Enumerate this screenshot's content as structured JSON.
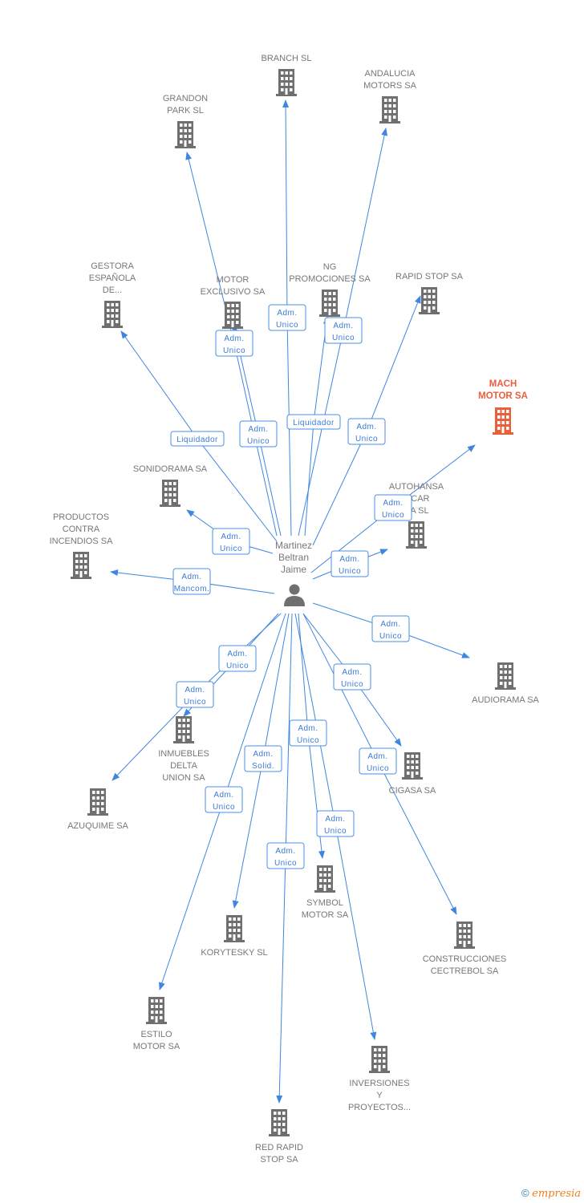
{
  "center": {
    "name_lines": [
      "Martinez",
      "Beltran",
      "Jaime"
    ],
    "icon": "person-icon"
  },
  "colors": {
    "edge": "#3f86e0",
    "company": "#6f6f6f",
    "highlight": "#e8603c"
  },
  "nodes": [
    {
      "lines": [
        "BRANCH SL"
      ]
    },
    {
      "lines": [
        "ANDALUCIA",
        "MOTORS SA"
      ]
    },
    {
      "lines": [
        "GRANDON",
        "PARK SL"
      ]
    },
    {
      "lines": [
        "GESTORA",
        "ESPAÑOLA",
        "DE..."
      ]
    },
    {
      "lines": [
        "MOTOR",
        "EXCLUSIVO SA"
      ]
    },
    {
      "lines": [
        "NG",
        "PROMOCIONES SA"
      ]
    },
    {
      "lines": [
        "RAPID STOP SA"
      ]
    },
    {
      "lines": [
        "MACH",
        "MOTOR SA"
      ],
      "highlight": true
    },
    {
      "lines": [
        "SONIDORAMA SA"
      ]
    },
    {
      "lines": [
        "AUTOHANSA",
        "A CAR",
        "CA SL"
      ]
    },
    {
      "lines": [
        "PRODUCTOS",
        "CONTRA",
        "INCENDIOS SA"
      ]
    },
    {
      "lines": [
        "AUDIORAMA SA"
      ]
    },
    {
      "lines": [
        "INMUEBLES",
        "DELTA",
        "UNION SA"
      ]
    },
    {
      "lines": [
        "CIGASA SA"
      ]
    },
    {
      "lines": [
        "AZUQUIME SA"
      ]
    },
    {
      "lines": [
        "SYMBOL",
        "MOTOR SA"
      ]
    },
    {
      "lines": [
        "KORYTESKY SL"
      ]
    },
    {
      "lines": [
        "CONSTRUCCIONES",
        "CECTREBOL SA"
      ]
    },
    {
      "lines": [
        "ESTILO",
        "MOTOR SA"
      ]
    },
    {
      "lines": [
        "INVERSIONES",
        "Y",
        "PROYECTOS..."
      ]
    },
    {
      "lines": [
        "RED RAPID",
        "STOP SA"
      ]
    }
  ],
  "edges": [
    {
      "target": 0,
      "role": [
        "Adm.",
        "Unico"
      ]
    },
    {
      "target": 2,
      "role": [
        "Adm.",
        "Unico"
      ]
    },
    {
      "target": 1,
      "role": [
        "Adm.",
        "Unico"
      ]
    },
    {
      "target": 3,
      "role": [
        "Liquidador"
      ]
    },
    {
      "target": 4,
      "role": [
        "Adm.",
        "Unico"
      ]
    },
    {
      "target": 5,
      "role": [
        "Liquidador"
      ]
    },
    {
      "target": 6,
      "role": [
        "Adm.",
        "Unico"
      ]
    },
    {
      "target": 7,
      "role": [
        "Adm.",
        "Unico"
      ]
    },
    {
      "target": 8,
      "role": [
        "Adm.",
        "Unico"
      ]
    },
    {
      "target": 9,
      "role": [
        "Adm.",
        "Unico"
      ]
    },
    {
      "target": 10,
      "role": [
        "Adm.",
        "Mancom."
      ]
    },
    {
      "target": 11,
      "role": [
        "Adm.",
        "Unico"
      ]
    },
    {
      "target": 12,
      "role": [
        "Adm.",
        "Unico"
      ]
    },
    {
      "target": 14,
      "role": [
        "Adm.",
        "Unico"
      ]
    },
    {
      "target": 13,
      "role": [
        "Adm.",
        "Unico"
      ]
    },
    {
      "target": 15,
      "role": [
        "Adm.",
        "Unico"
      ]
    },
    {
      "target": 16,
      "role": [
        "Adm.",
        "Solid."
      ]
    },
    {
      "target": 17,
      "role": [
        "Adm.",
        "Unico"
      ]
    },
    {
      "target": 18,
      "role": [
        "Adm.",
        "Unico"
      ]
    },
    {
      "target": 19,
      "role": [
        "Adm.",
        "Unico"
      ]
    },
    {
      "target": 20,
      "role": [
        "Adm.",
        "Unico"
      ]
    }
  ],
  "footer": {
    "copyright": "©",
    "brand": "empresia"
  }
}
